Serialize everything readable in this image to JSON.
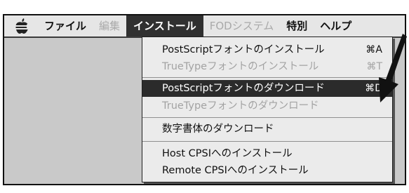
{
  "menubar": {
    "apple_icon": "apple-logo-icon",
    "items": [
      {
        "label": "ファイル",
        "state": "normal"
      },
      {
        "label": "編集",
        "state": "disabled"
      },
      {
        "label": "インストール",
        "state": "active"
      },
      {
        "label": "FODシステム",
        "state": "disabled"
      },
      {
        "label": "特別",
        "state": "normal"
      },
      {
        "label": "ヘルプ",
        "state": "normal"
      }
    ]
  },
  "dropdown": {
    "items": [
      {
        "label": "PostScriptフォントのインストール",
        "shortcut": "⌘A",
        "state": "normal"
      },
      {
        "label": "TrueTypeフォントのインストール",
        "shortcut": "⌘T",
        "state": "disabled"
      },
      {
        "label": "PostScriptフォントのダウンロード",
        "shortcut": "⌘D",
        "state": "highlight"
      },
      {
        "label": "TrueTypeフォントのダウンロード",
        "shortcut": "",
        "state": "disabled"
      },
      {
        "label": "数字書体のダウンロード",
        "shortcut": "",
        "state": "normal"
      },
      {
        "label": "Host CPSIへのインストール",
        "shortcut": "",
        "state": "normal"
      },
      {
        "label": "Remote CPSIへのインストール",
        "shortcut": "",
        "state": "normal"
      }
    ]
  },
  "annotation": {
    "pointer_icon": "arrow-pointer-icon",
    "color": "#111111"
  },
  "colors": {
    "menubar_bg": "#e6e6e6",
    "highlight_bg": "#2b2b2b",
    "disabled_text": "#a9a9a9",
    "desktop_bg": "#c9c9c9"
  }
}
